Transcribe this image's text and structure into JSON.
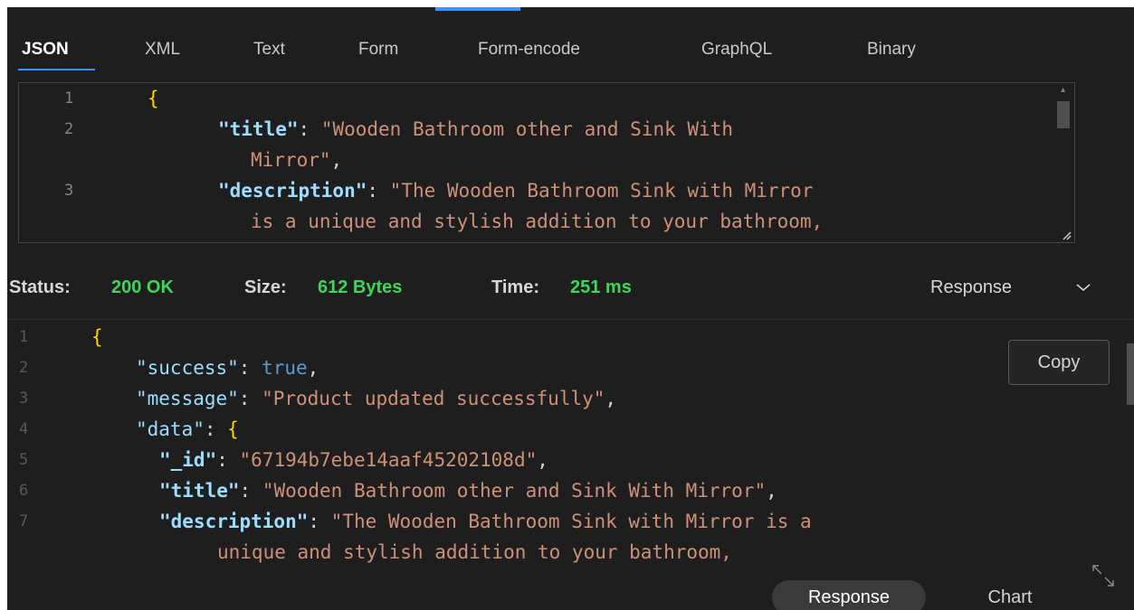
{
  "body_tabs": [
    {
      "label": "JSON",
      "active": true
    },
    {
      "label": "XML",
      "active": false
    },
    {
      "label": "Text",
      "active": false
    },
    {
      "label": "Form",
      "active": false
    },
    {
      "label": "Form-encode",
      "active": false
    },
    {
      "label": "GraphQL",
      "active": false
    },
    {
      "label": "Binary",
      "active": false
    }
  ],
  "request_editor": {
    "lines": [
      {
        "num": "1",
        "content": "{"
      },
      {
        "num": "2",
        "key": "\"title\"",
        "sep": ": ",
        "value": "\"Wooden Bathroom other and Sink With"
      },
      {
        "num": "",
        "value": "Mirror\"",
        "tail": ","
      },
      {
        "num": "3",
        "key": "\"description\"",
        "sep": ": ",
        "value": "\"The Wooden Bathroom Sink with Mirror"
      },
      {
        "num": "",
        "value": "is a unique and stylish addition to your bathroom,"
      }
    ]
  },
  "status": {
    "status_label": "Status:",
    "status_value": "200 OK",
    "size_label": "Size:",
    "size_value": "612 Bytes",
    "time_label": "Time:",
    "time_value": "251 ms",
    "view_select": "Response"
  },
  "response_viewer": {
    "copy_label": "Copy",
    "lines": [
      {
        "num": "1",
        "content": "{"
      },
      {
        "num": "2",
        "key": "\"success\"",
        "sep": ": ",
        "bool": "true",
        "tail": ","
      },
      {
        "num": "3",
        "key": "\"message\"",
        "sep": ": ",
        "value": "\"Product updated successfully\"",
        "tail": ","
      },
      {
        "num": "4",
        "key": "\"data\"",
        "sep": ": ",
        "open": "{"
      },
      {
        "num": "5",
        "key": "\"_id\"",
        "sep": ": ",
        "value": "\"67194b7ebe14aaf45202108d\"",
        "tail": ","
      },
      {
        "num": "6",
        "key": "\"title\"",
        "sep": ": ",
        "value": "\"Wooden Bathroom other and Sink With Mirror\"",
        "tail": ","
      },
      {
        "num": "7",
        "key": "\"description\"",
        "sep": ": ",
        "value": "\"The Wooden Bathroom Sink with Mirror is a"
      },
      {
        "num": "",
        "value": "unique and stylish addition to your bathroom,"
      }
    ],
    "toggle_response": "Response",
    "toggle_chart": "Chart"
  },
  "colors": {
    "accent": "#3794ff",
    "status_ok": "#3ed65a",
    "json_key": "#9cdcfe",
    "json_string": "#ce9178",
    "json_bool": "#569cd6",
    "json_brace": "#ffd700"
  },
  "icons": {
    "response_chevron": "chevron-down-icon",
    "expand": "expand-icon",
    "resize": "resize-grip-icon"
  }
}
